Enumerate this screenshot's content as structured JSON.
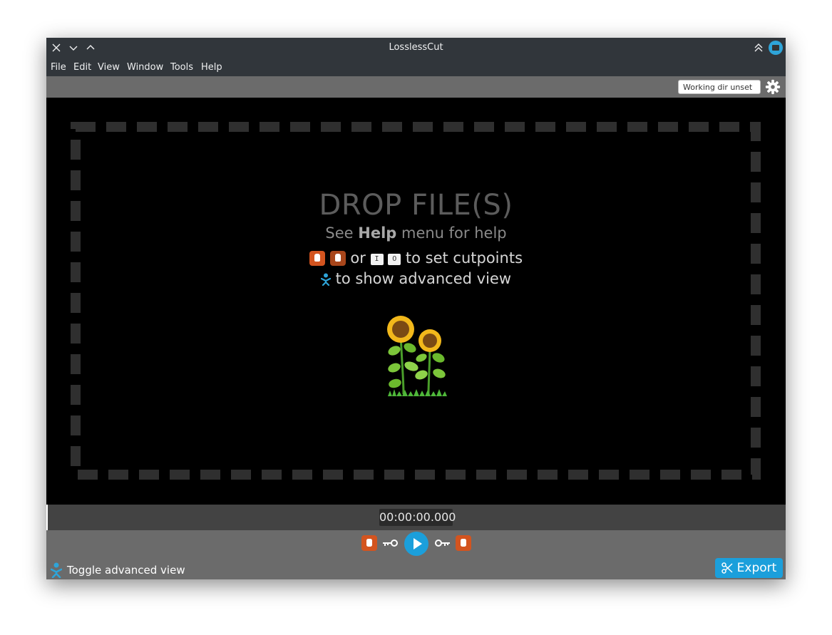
{
  "window": {
    "title": "LosslessCut"
  },
  "menu": {
    "items": [
      "File",
      "Edit",
      "View",
      "Window",
      "Tools",
      "Help"
    ]
  },
  "topbar": {
    "working_dir": "Working dir unset"
  },
  "dropzone": {
    "title": "DROP FILE(S)",
    "help_prefix": "See ",
    "help_bold": "Help",
    "help_suffix": " menu for help",
    "cut_or": "or",
    "key_in": "I",
    "key_out": "O",
    "cut_suffix": "to set cutpoints",
    "advanced_text": "to show advanced view"
  },
  "timeline": {
    "timecode": "00:00:00.000"
  },
  "bottom": {
    "toggle_label": "Toggle advanced view",
    "export_label": "Export"
  },
  "colors": {
    "accent": "#1b9fdb",
    "hand": "#d3541f",
    "panel": "#6b6b6b",
    "titlebar": "#31363b"
  }
}
